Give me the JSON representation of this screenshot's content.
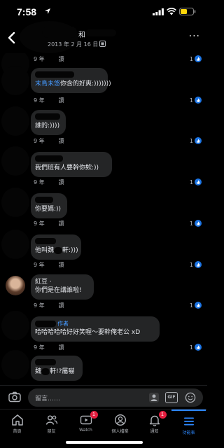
{
  "status_bar": {
    "time": "7:58"
  },
  "header": {
    "name_suffix": "和",
    "date": "2013 年 2 月 16 日",
    "more": "···"
  },
  "comments": [
    {
      "age": "9 年",
      "reply": "讚",
      "likes": "1"
    },
    {
      "mention": "末島未悠",
      "text": "你含的好爽:)))))))",
      "age": "9 年",
      "reply": "讚",
      "likes": "1"
    },
    {
      "text": "誰的:))))",
      "age": "9 年",
      "reply": "讚",
      "likes": "1"
    },
    {
      "text": "我們班有人要幹你欸:))",
      "age": "9 年",
      "reply": "讚",
      "likes": "1"
    },
    {
      "text": "你要媽:))",
      "age": "9 年",
      "reply": "讚",
      "likes": "1"
    },
    {
      "text_before": "他叫魏",
      "text_after": "軒:)))",
      "age": "9 年",
      "reply": "讚",
      "likes": "1"
    },
    {
      "name": "紅豆 ·",
      "text": "你們是在講誰啦!",
      "age": "9 年",
      "reply": "讚",
      "likes": "1"
    },
    {
      "author_tag": "作者",
      "text": "哈哈哈哈哈好好笑喔～要幹俺老公 xD",
      "age": "9 年",
      "reply": "讚",
      "likes": "1"
    },
    {
      "text_before": "魏",
      "text_after": "軒!?屬嚇"
    }
  ],
  "composer": {
    "placeholder": "留言……",
    "gif": "GIF"
  },
  "tabs": [
    {
      "label": "首頁",
      "icon": "home-icon"
    },
    {
      "label": "朋友",
      "icon": "friends-icon"
    },
    {
      "label": "Watch",
      "icon": "watch-icon",
      "badge": "1"
    },
    {
      "label": "個人檔案",
      "icon": "profile-icon"
    },
    {
      "label": "通知",
      "icon": "bell-icon",
      "badge": "1"
    },
    {
      "label": "功能表",
      "icon": "menu-icon",
      "active": true
    }
  ],
  "colors": {
    "accent": "#2d88ff",
    "badge": "#e41e3f",
    "bubble": "#242526"
  }
}
